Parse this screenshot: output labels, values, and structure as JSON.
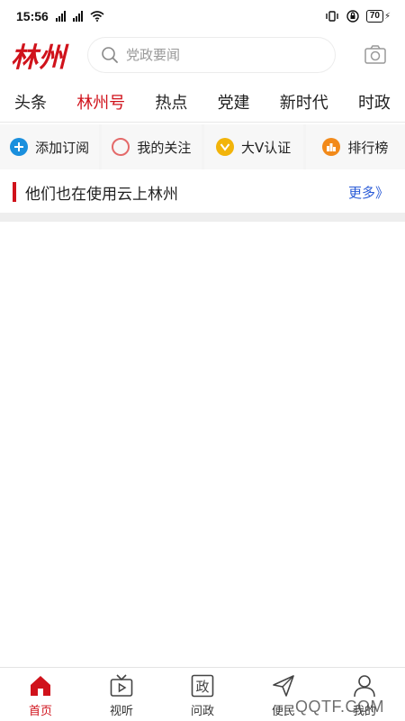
{
  "status_bar": {
    "time": "15:56",
    "signal_1": "5G",
    "signal_2": "5G",
    "battery": "70"
  },
  "header": {
    "logo": "林州",
    "search_placeholder": "党政要闻"
  },
  "tabs": [
    {
      "label": "头条",
      "active": false
    },
    {
      "label": "林州号",
      "active": true
    },
    {
      "label": "热点",
      "active": false
    },
    {
      "label": "党建",
      "active": false
    },
    {
      "label": "新时代",
      "active": false
    },
    {
      "label": "时政",
      "active": false
    }
  ],
  "quick_actions": [
    {
      "label": "添加订阅",
      "icon": "plus-circle-icon",
      "color": "#1a8fdd"
    },
    {
      "label": "我的关注",
      "icon": "ring-icon",
      "color": "#e46a6a"
    },
    {
      "label": "大V认证",
      "icon": "check-circle-icon",
      "color": "#f2b40a"
    },
    {
      "label": "排行榜",
      "icon": "bar-chart-icon",
      "color": "#f28a1a"
    }
  ],
  "section": {
    "title": "他们也在使用云上林州",
    "more": "更多》"
  },
  "bottom_nav": [
    {
      "label": "首页",
      "icon": "home-icon",
      "active": true
    },
    {
      "label": "视听",
      "icon": "tv-play-icon",
      "active": false
    },
    {
      "label": "问政",
      "icon": "zheng-icon",
      "glyph": "政",
      "active": false
    },
    {
      "label": "便民",
      "icon": "paper-plane-icon",
      "active": false
    },
    {
      "label": "我的",
      "icon": "user-icon",
      "active": false
    }
  ],
  "watermark": "QQTF.COM",
  "colors": {
    "brand_red": "#d0121b",
    "link_blue": "#2a5bd7"
  }
}
